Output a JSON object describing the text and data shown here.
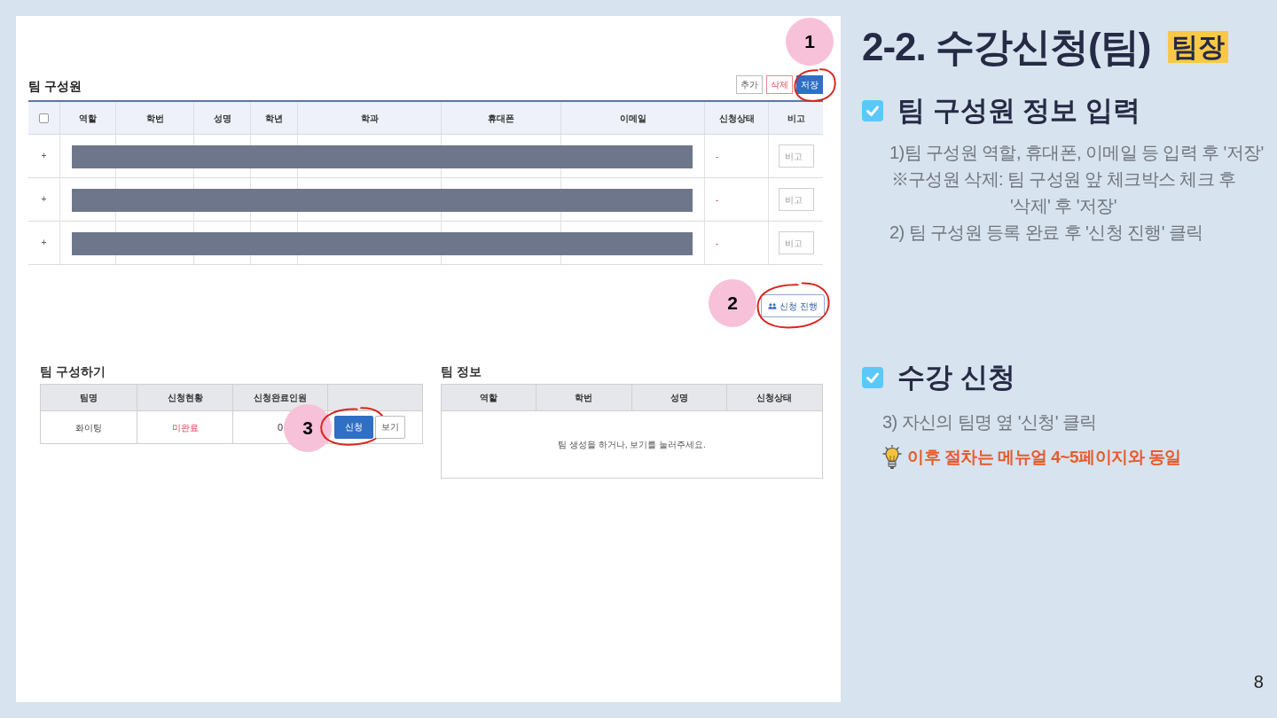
{
  "screen": {
    "members": {
      "title": "팀 구성원",
      "buttons": [
        {
          "label": "추가",
          "kind": "default",
          "circled": false
        },
        {
          "label": "삭제",
          "kind": "danger",
          "circled": false
        },
        {
          "label": "저장",
          "kind": "primary",
          "circled": true,
          "step": "1"
        }
      ],
      "header_checkbox": {
        "checked": false
      },
      "columns": [
        "역할",
        "학번",
        "성명",
        "학년",
        "학과",
        "휴대폰",
        "이메일",
        "신청상태",
        "비고"
      ],
      "rows": [
        {
          "expander": "+",
          "redacted": true,
          "status": "-",
          "remark_placeholder": "비고"
        },
        {
          "expander": "+",
          "redacted": true,
          "status": "-",
          "remark_placeholder": "비고"
        },
        {
          "expander": "+",
          "redacted": true,
          "status": "-",
          "remark_placeholder": "비고"
        }
      ]
    },
    "proceed_button": {
      "label": "신청 진행",
      "circled": true,
      "step": "2"
    },
    "team_build": {
      "title": "팀 구성하기",
      "columns": [
        "팀명",
        "신청현황",
        "신청완료인원"
      ],
      "rows": [
        {
          "team_name": "화이팅",
          "status": "미완료",
          "completed": "0",
          "buttons": [
            {
              "label": "신청",
              "kind": "primary",
              "circled": true,
              "step": "3"
            },
            {
              "label": "보기",
              "kind": "default",
              "circled": false
            }
          ]
        }
      ]
    },
    "team_info": {
      "title": "팀 정보",
      "columns": [
        "역할",
        "학번",
        "성명",
        "신청상태"
      ],
      "empty_message": "팀 생성을 하거나, 보기를 눌러주세요."
    }
  },
  "guide": {
    "title": "2-2. 수강신청(팀)",
    "badge": "팀장",
    "sections": [
      {
        "heading": "팀 구성원 정보 입력",
        "checked": true,
        "lines": [
          {
            "kind": "step",
            "text": "1)팀 구성원 역할, 휴대폰, 이메일 등 입력 후 '저장'"
          },
          {
            "kind": "note",
            "text": "※구성원 삭제: 팀 구성원 앞 체크박스 체크 후 '삭제' 후 '저장'"
          },
          {
            "kind": "step",
            "text": "2) 팀 구성원 등록 완료 후 '신청 진행' 클릭"
          }
        ]
      },
      {
        "heading": "수강 신청",
        "checked": true,
        "lines": [
          {
            "kind": "step",
            "text": "3) 자신의 팀명 옆 '신청' 클릭"
          },
          {
            "kind": "tip",
            "text": "이후 절차는 메뉴얼 4~5페이지와 동일"
          }
        ]
      }
    ]
  },
  "page_number": "8"
}
